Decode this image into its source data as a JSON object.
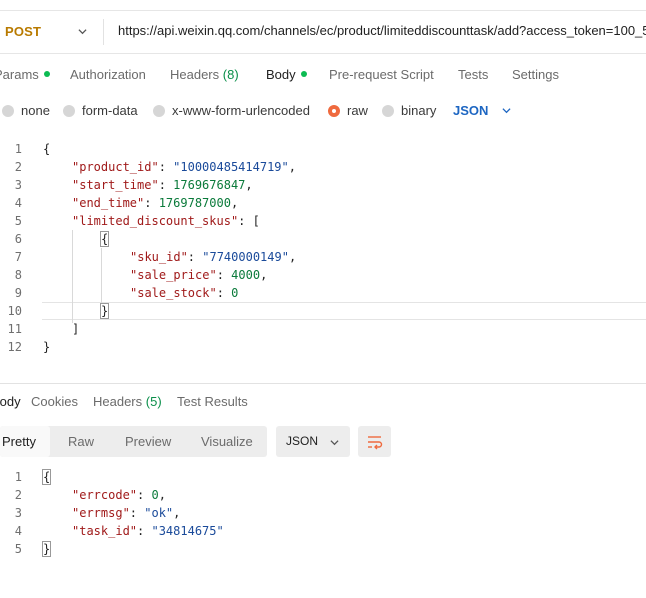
{
  "request": {
    "method": "POST",
    "url": "https://api.weixin.qq.com/channels/ec/product/limiteddiscounttask/add?access_token=100_5",
    "tabs": {
      "params": "Params",
      "authorization": "Authorization",
      "headers": "Headers",
      "headers_count": "(8)",
      "body": "Body",
      "prerequest": "Pre-request Script",
      "tests": "Tests",
      "settings": "Settings"
    },
    "body_types": {
      "none": "none",
      "form_data": "form-data",
      "urlencoded": "x-www-form-urlencoded",
      "raw": "raw",
      "binary": "binary",
      "format": "JSON"
    },
    "line_numbers": [
      "1",
      "2",
      "3",
      "4",
      "5",
      "6",
      "7",
      "8",
      "9",
      "10",
      "11",
      "12"
    ],
    "code": {
      "l1": "{",
      "product_id_key": "\"product_id\"",
      "product_id_val": "\"10000485414719\"",
      "start_time_key": "\"start_time\"",
      "start_time_val": "1769676847",
      "end_time_key": "\"end_time\"",
      "end_time_val": "1769787000",
      "skus_key": "\"limited_discount_skus\"",
      "l6": "{",
      "sku_id_key": "\"sku_id\"",
      "sku_id_val": "\"7740000149\"",
      "sale_price_key": "\"sale_price\"",
      "sale_price_val": "4000",
      "sale_stock_key": "\"sale_stock\"",
      "sale_stock_val": "0",
      "l10": "}",
      "l11": "]",
      "l12": "}"
    }
  },
  "response": {
    "tabs": {
      "body": "Body",
      "cookies": "Cookies",
      "headers": "Headers",
      "headers_count": "(5)",
      "test_results": "Test Results"
    },
    "views": {
      "pretty": "Pretty",
      "raw": "Raw",
      "preview": "Preview",
      "visualize": "Visualize",
      "format": "JSON"
    },
    "line_numbers": [
      "1",
      "2",
      "3",
      "4",
      "5"
    ],
    "code": {
      "l1": "{",
      "errcode_key": "\"errcode\"",
      "errcode_val": "0",
      "errmsg_key": "\"errmsg\"",
      "errmsg_val": "\"ok\"",
      "task_id_key": "\"task_id\"",
      "task_id_val": "\"34814675\"",
      "l5": "}"
    }
  },
  "colors": {
    "accent_orange": "#ef6a3e",
    "status_green": "#0cbb52",
    "link_blue": "#1d66c2"
  }
}
